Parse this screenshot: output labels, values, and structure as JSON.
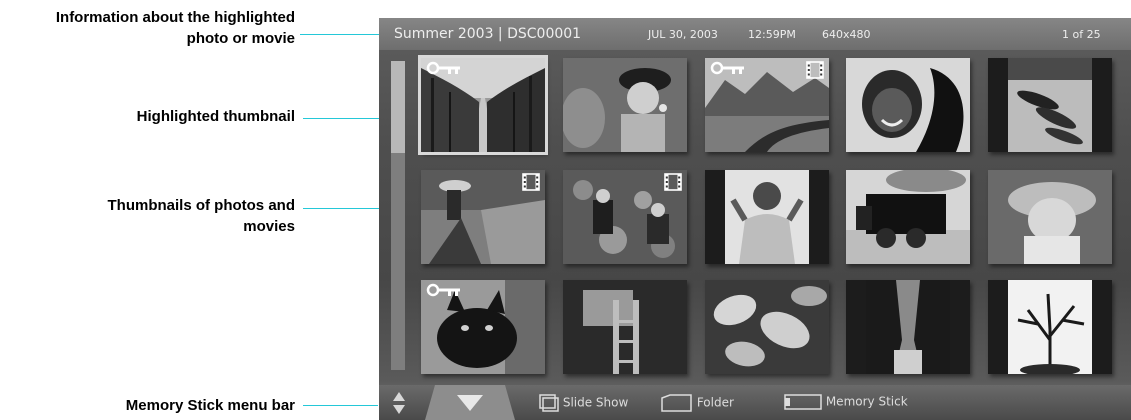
{
  "annotations": {
    "info": "Information about the highlighted photo or movie",
    "info_line1": "Information about the highlighted",
    "info_line2": "photo or movie",
    "highlighted": "Highlighted thumbnail",
    "thumbs_line1": "Thumbnails of photos and",
    "thumbs_line2": "movies",
    "menubar": "Memory Stick menu bar"
  },
  "header": {
    "album_and_file": "Summer 2003 | DSC00001",
    "date": "JUL 30, 2003",
    "time": "12:59PM",
    "resolution": "640x480",
    "counter": "1 of 25"
  },
  "thumbnails": [
    {
      "label": "Tree-lined road",
      "selected": true,
      "protected": true,
      "movie": false
    },
    {
      "label": "Child blowing bubbles",
      "selected": false,
      "protected": false,
      "movie": false
    },
    {
      "label": "Desert road",
      "selected": false,
      "protected": true,
      "movie": true
    },
    {
      "label": "Smiling girl",
      "selected": false,
      "protected": false,
      "movie": false
    },
    {
      "label": "Rowboats",
      "selected": false,
      "protected": false,
      "movie": false
    },
    {
      "label": "Woman in grass",
      "selected": false,
      "protected": false,
      "movie": true
    },
    {
      "label": "Kids in leaves",
      "selected": false,
      "protected": false,
      "movie": true
    },
    {
      "label": "Boy in shirt",
      "selected": false,
      "protected": false,
      "movie": false
    },
    {
      "label": "Steam locomotive",
      "selected": false,
      "protected": false,
      "movie": false
    },
    {
      "label": "Baby in hat",
      "selected": false,
      "protected": false,
      "movie": false
    },
    {
      "label": "Black cat",
      "selected": false,
      "protected": true,
      "movie": false
    },
    {
      "label": "Attic with ladder",
      "selected": false,
      "protected": false,
      "movie": false
    },
    {
      "label": "Leaves close-up",
      "selected": false,
      "protected": false,
      "movie": false
    },
    {
      "label": "Canyon stream",
      "selected": false,
      "protected": false,
      "movie": false
    },
    {
      "label": "Bare tree",
      "selected": false,
      "protected": false,
      "movie": false
    }
  ],
  "menubar": {
    "slideshow": "Slide Show",
    "folder": "Folder",
    "memory_stick": "Memory Stick"
  },
  "colors": {
    "leader_line": "#24c8d8",
    "header_bg": "#7a7a7a",
    "screen_bg": "#4f4f4f"
  }
}
